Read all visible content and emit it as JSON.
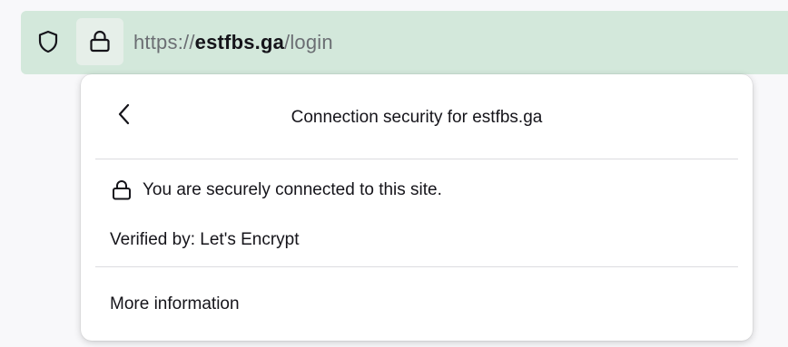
{
  "browser": {
    "url": {
      "prefix": "https://",
      "domain": "estfbs.ga",
      "path": "/login"
    },
    "icons": {
      "tracking_protection": "shield-icon",
      "site_security": "lock-icon"
    },
    "colors": {
      "urlbar_background": "#d3e8db",
      "text": "#15141a",
      "url_muted": "#6b6e73"
    }
  },
  "security_panel": {
    "title": "Connection security for estfbs.ga",
    "back_icon": "chevron-left-icon",
    "status_icon": "lock-icon",
    "status_text": "You are securely connected to this site.",
    "verified_by": "Verified by: Let's Encrypt",
    "more_information": "More information"
  }
}
